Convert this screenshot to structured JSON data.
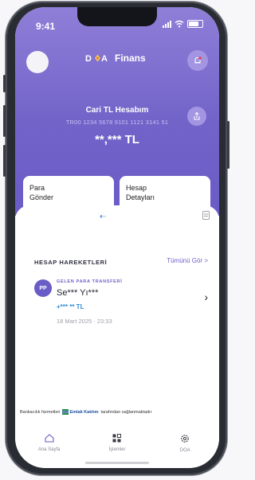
{
  "status": {
    "time": "9:41"
  },
  "header": {
    "brand_name": "Finans",
    "brand_mark": "DOA"
  },
  "account": {
    "title": "Cari TL Hesabım",
    "number": "TR00 1234 5678 9101 1121 3141 51",
    "balance": "**,*** TL"
  },
  "actions": [
    {
      "line1": "Para",
      "line2": "Gönder"
    },
    {
      "line1": "Hesap",
      "line2": "Detayları"
    }
  ],
  "transactions": {
    "header": "HESAP HAREKETLERİ",
    "see_all": "Tümünü Gör >",
    "items": [
      {
        "initials": "PP",
        "type": "GELEN PARA TRANSFERİ",
        "name": "Se*** Yı***",
        "amount": "+*** ** TL",
        "date": "18 Mart 2025 · 23:33"
      }
    ]
  },
  "footer": {
    "prefix": "Bankacılık hizmetleri",
    "bank": "Emlak Katılım",
    "suffix": "tarafından sağlanmaktadır"
  },
  "tabs": [
    {
      "label": "Ana Sayfa",
      "icon": "home-icon"
    },
    {
      "label": "İşlemler",
      "icon": "grid-icon"
    },
    {
      "label": "DOA",
      "icon": "gear-icon"
    }
  ],
  "colors": {
    "primary": "#6a5cc6",
    "accent_blue": "#2f8bd6",
    "notification": "#e23b5a"
  }
}
